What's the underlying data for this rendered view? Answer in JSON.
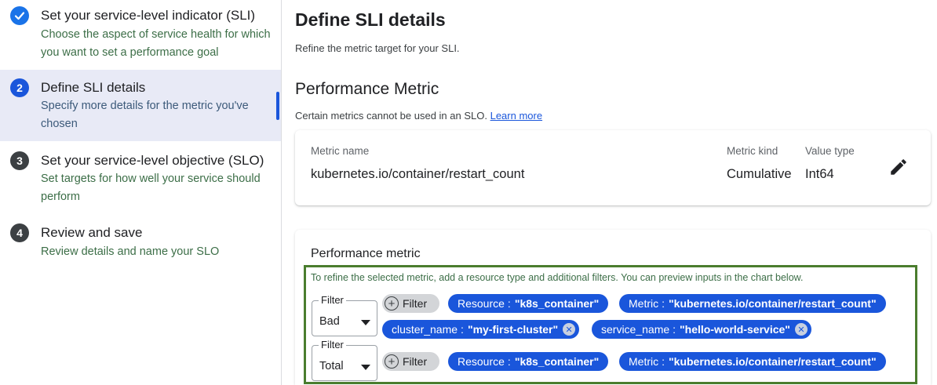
{
  "steps": [
    {
      "number": "1",
      "title": "Set your service-level indicator (SLI)",
      "description": "Choose the aspect of service health for which you want to set a performance goal",
      "state": "done"
    },
    {
      "number": "2",
      "title": "Define SLI details",
      "description": "Specify more details for the metric you've chosen",
      "state": "current"
    },
    {
      "number": "3",
      "title": "Set your service-level objective (SLO)",
      "description": "Set targets for how well your service should perform",
      "state": "todo"
    },
    {
      "number": "4",
      "title": "Review and save",
      "description": "Review details and name your SLO",
      "state": "todo"
    }
  ],
  "header": {
    "title": "Define SLI details",
    "subtitle": "Refine the metric target for your SLI."
  },
  "performance_section": {
    "title": "Performance Metric",
    "note": "Certain metrics cannot be used in an SLO.",
    "learn_more": "Learn more"
  },
  "metric_card": {
    "name_label": "Metric name",
    "name_value": "kubernetes.io/container/restart_count",
    "kind_label": "Metric kind",
    "kind_value": "Cumulative",
    "type_label": "Value type",
    "type_value": "Int64",
    "edit_icon": "pencil-icon"
  },
  "perf_card": {
    "title": "Performance metric",
    "hint": "To refine the selected metric, add a resource type and additional filters. You can preview inputs in the chart below.",
    "filter_rows": [
      {
        "select_label": "Filter",
        "select_value": "Bad",
        "add_label": "Filter",
        "chips": [
          {
            "key": "Resource",
            "value": "\"k8s_container\""
          },
          {
            "key": "Metric",
            "value": "\"kubernetes.io/container/restart_count\""
          },
          {
            "key": "cluster_name",
            "value": "\"my-first-cluster\""
          },
          {
            "key": "service_name",
            "value": "\"hello-world-service\""
          }
        ]
      },
      {
        "select_label": "Filter",
        "select_value": "Total",
        "add_label": "Filter",
        "chips": [
          {
            "key": "Resource",
            "value": "\"k8s_container\""
          },
          {
            "key": "Metric",
            "value": "\"kubernetes.io/container/restart_count\""
          }
        ]
      }
    ]
  },
  "colors": {
    "accent": "#1a56db",
    "highlight_border": "#4a7d2e",
    "active_step_bg": "#e8eaf6"
  }
}
